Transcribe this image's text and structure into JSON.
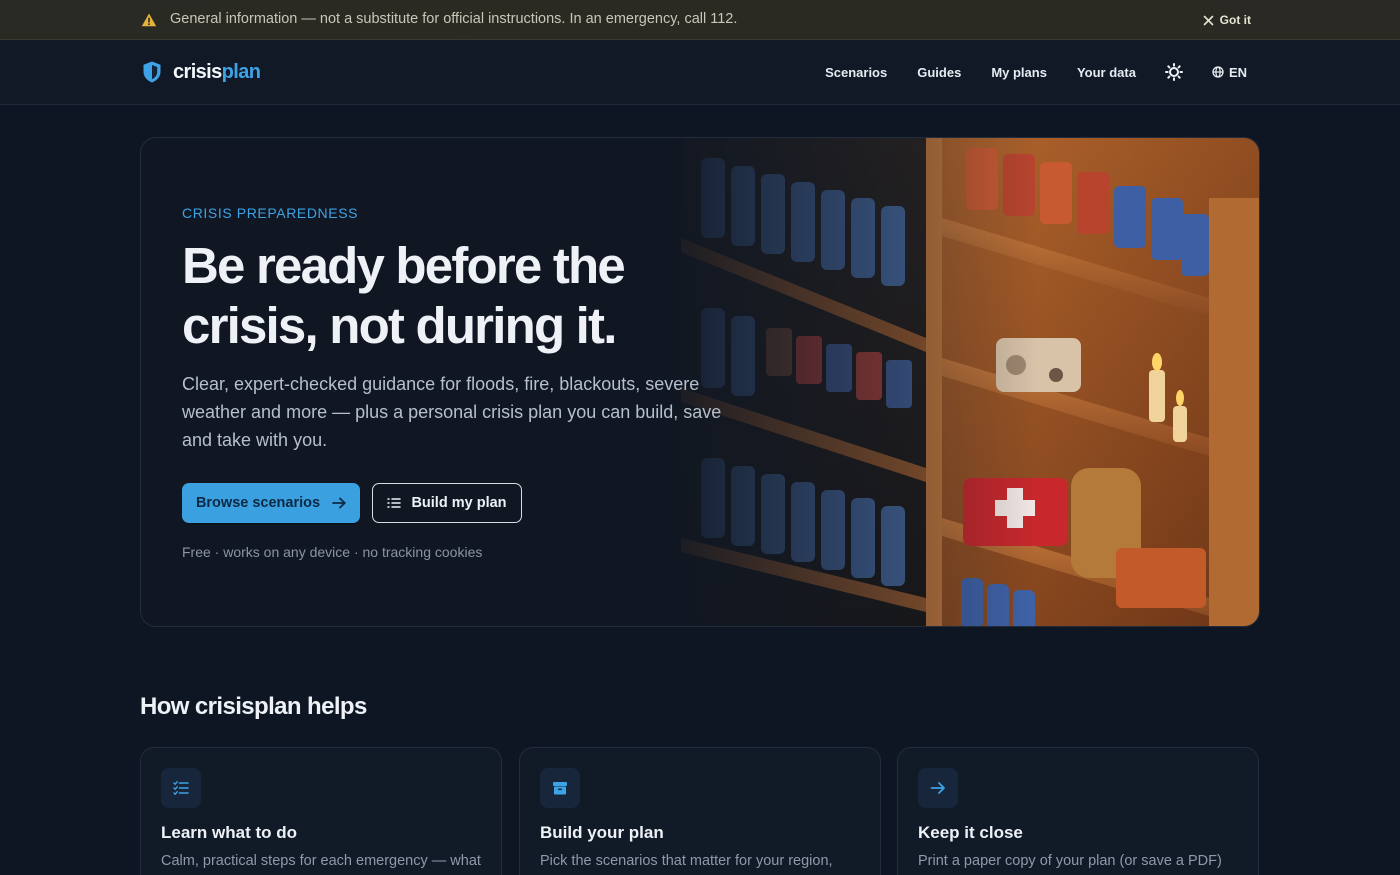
{
  "notice": {
    "text": "General information — not a substitute for official instructions. In an emergency, call 112.",
    "dismiss_label": "Got it",
    "icon": "warning-icon"
  },
  "header": {
    "logo_primary": "crisis",
    "logo_accent": "plan",
    "logo_icon": "shield-icon",
    "nav": {
      "scenarios": "Scenarios",
      "guides": "Guides",
      "my_plans": "My plans",
      "your_data": "Your data"
    },
    "theme_icon": "sun-icon",
    "language": "EN",
    "language_icon": "globe-icon"
  },
  "hero": {
    "eyebrow": "CRISIS PREPAREDNESS",
    "headline": "Be ready before the crisis, not during it.",
    "lede": "Clear, expert-checked guidance for floods, fire, blackouts, severe weather and more — plus a personal crisis plan you can build, save and take with you.",
    "primary_cta": "Browse scenarios",
    "secondary_cta": "Build my plan",
    "fineprint": "Free · works on any device · no tracking cookies",
    "image": "emergency-supplies-shelf-illustration"
  },
  "how": {
    "title": "How crisisplan helps",
    "cards": [
      {
        "icon": "checklist-icon",
        "title": "Learn what to do",
        "desc": "Calm, practical steps for each emergency — what to do right now and how to prepare in advance."
      },
      {
        "icon": "archive-icon",
        "title": "Build your plan",
        "desc": "Pick the scenarios that matter for your region, mark the ready-made checklists and keep contacts close."
      },
      {
        "icon": "arrow-right-icon",
        "title": "Keep it close",
        "desc": "Print a paper copy of your plan (or save a PDF) and keep it where everyone can reach it when the power is out."
      }
    ]
  },
  "colors": {
    "accent": "#3ea2e6",
    "background": "#0f1623",
    "notice_bg": "#2a2a24"
  }
}
